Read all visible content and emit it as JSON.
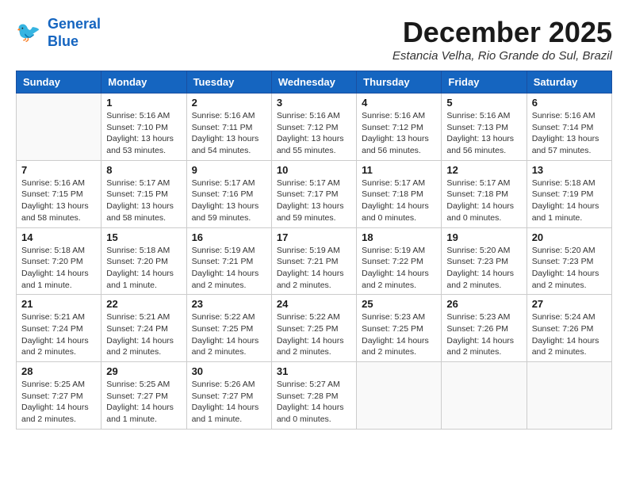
{
  "header": {
    "logo_line1": "General",
    "logo_line2": "Blue",
    "month": "December 2025",
    "location": "Estancia Velha, Rio Grande do Sul, Brazil"
  },
  "weekdays": [
    "Sunday",
    "Monday",
    "Tuesday",
    "Wednesday",
    "Thursday",
    "Friday",
    "Saturday"
  ],
  "weeks": [
    [
      {
        "day": null
      },
      {
        "day": "1",
        "sunrise": "5:16 AM",
        "sunset": "7:10 PM",
        "daylight": "13 hours and 53 minutes."
      },
      {
        "day": "2",
        "sunrise": "5:16 AM",
        "sunset": "7:11 PM",
        "daylight": "13 hours and 54 minutes."
      },
      {
        "day": "3",
        "sunrise": "5:16 AM",
        "sunset": "7:12 PM",
        "daylight": "13 hours and 55 minutes."
      },
      {
        "day": "4",
        "sunrise": "5:16 AM",
        "sunset": "7:12 PM",
        "daylight": "13 hours and 56 minutes."
      },
      {
        "day": "5",
        "sunrise": "5:16 AM",
        "sunset": "7:13 PM",
        "daylight": "13 hours and 56 minutes."
      },
      {
        "day": "6",
        "sunrise": "5:16 AM",
        "sunset": "7:14 PM",
        "daylight": "13 hours and 57 minutes."
      }
    ],
    [
      {
        "day": "7",
        "sunrise": "5:16 AM",
        "sunset": "7:15 PM",
        "daylight": "13 hours and 58 minutes."
      },
      {
        "day": "8",
        "sunrise": "5:17 AM",
        "sunset": "7:15 PM",
        "daylight": "13 hours and 58 minutes."
      },
      {
        "day": "9",
        "sunrise": "5:17 AM",
        "sunset": "7:16 PM",
        "daylight": "13 hours and 59 minutes."
      },
      {
        "day": "10",
        "sunrise": "5:17 AM",
        "sunset": "7:17 PM",
        "daylight": "13 hours and 59 minutes."
      },
      {
        "day": "11",
        "sunrise": "5:17 AM",
        "sunset": "7:18 PM",
        "daylight": "14 hours and 0 minutes."
      },
      {
        "day": "12",
        "sunrise": "5:17 AM",
        "sunset": "7:18 PM",
        "daylight": "14 hours and 0 minutes."
      },
      {
        "day": "13",
        "sunrise": "5:18 AM",
        "sunset": "7:19 PM",
        "daylight": "14 hours and 1 minute."
      }
    ],
    [
      {
        "day": "14",
        "sunrise": "5:18 AM",
        "sunset": "7:20 PM",
        "daylight": "14 hours and 1 minute."
      },
      {
        "day": "15",
        "sunrise": "5:18 AM",
        "sunset": "7:20 PM",
        "daylight": "14 hours and 1 minute."
      },
      {
        "day": "16",
        "sunrise": "5:19 AM",
        "sunset": "7:21 PM",
        "daylight": "14 hours and 2 minutes."
      },
      {
        "day": "17",
        "sunrise": "5:19 AM",
        "sunset": "7:21 PM",
        "daylight": "14 hours and 2 minutes."
      },
      {
        "day": "18",
        "sunrise": "5:19 AM",
        "sunset": "7:22 PM",
        "daylight": "14 hours and 2 minutes."
      },
      {
        "day": "19",
        "sunrise": "5:20 AM",
        "sunset": "7:23 PM",
        "daylight": "14 hours and 2 minutes."
      },
      {
        "day": "20",
        "sunrise": "5:20 AM",
        "sunset": "7:23 PM",
        "daylight": "14 hours and 2 minutes."
      }
    ],
    [
      {
        "day": "21",
        "sunrise": "5:21 AM",
        "sunset": "7:24 PM",
        "daylight": "14 hours and 2 minutes."
      },
      {
        "day": "22",
        "sunrise": "5:21 AM",
        "sunset": "7:24 PM",
        "daylight": "14 hours and 2 minutes."
      },
      {
        "day": "23",
        "sunrise": "5:22 AM",
        "sunset": "7:25 PM",
        "daylight": "14 hours and 2 minutes."
      },
      {
        "day": "24",
        "sunrise": "5:22 AM",
        "sunset": "7:25 PM",
        "daylight": "14 hours and 2 minutes."
      },
      {
        "day": "25",
        "sunrise": "5:23 AM",
        "sunset": "7:25 PM",
        "daylight": "14 hours and 2 minutes."
      },
      {
        "day": "26",
        "sunrise": "5:23 AM",
        "sunset": "7:26 PM",
        "daylight": "14 hours and 2 minutes."
      },
      {
        "day": "27",
        "sunrise": "5:24 AM",
        "sunset": "7:26 PM",
        "daylight": "14 hours and 2 minutes."
      }
    ],
    [
      {
        "day": "28",
        "sunrise": "5:25 AM",
        "sunset": "7:27 PM",
        "daylight": "14 hours and 2 minutes."
      },
      {
        "day": "29",
        "sunrise": "5:25 AM",
        "sunset": "7:27 PM",
        "daylight": "14 hours and 1 minute."
      },
      {
        "day": "30",
        "sunrise": "5:26 AM",
        "sunset": "7:27 PM",
        "daylight": "14 hours and 1 minute."
      },
      {
        "day": "31",
        "sunrise": "5:27 AM",
        "sunset": "7:28 PM",
        "daylight": "14 hours and 0 minutes."
      },
      {
        "day": null
      },
      {
        "day": null
      },
      {
        "day": null
      }
    ]
  ]
}
